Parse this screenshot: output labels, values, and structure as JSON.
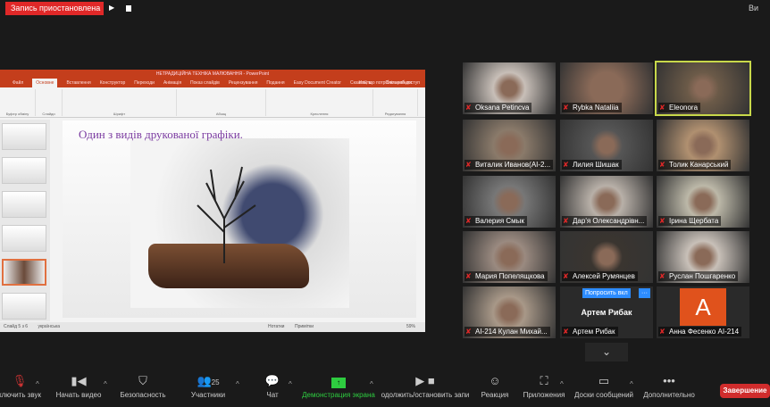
{
  "recording": {
    "status": "Запись приостановлена",
    "view_label": "Ви"
  },
  "powerpoint": {
    "title": "НЕТРАДИЦІЙНА ТЕХНІКА МАЛЮВАННЯ - PowerPoint",
    "tabs": [
      "Файл",
      "Основне",
      "Вставлення",
      "Конструктор",
      "Переходи",
      "Анімація",
      "Показ слайдів",
      "Рецензування",
      "Подання",
      "Easy Document Creator",
      "Скажіть, що потрібно зробити"
    ],
    "sign_in": "Увійти",
    "share": "Спільний доступ",
    "groups": [
      "Буфер обміну",
      "Слайди",
      "Шрифт",
      "Абзац",
      "Креслення",
      "Редагування"
    ],
    "slide_title": "Один з видів друкованої графіки.",
    "status": {
      "slide": "Слайд 5 з 6",
      "language": "українська",
      "notes": "Нотатки",
      "comments": "Примітки",
      "zoom": "59%"
    }
  },
  "participants": [
    {
      "name": "Oksana Petincva",
      "color": "#c8bfb8"
    },
    {
      "name": "Rybka Nataliia",
      "color": "#8a6a58"
    },
    {
      "name": "Eleonora",
      "color": "#6b5a48",
      "active": true
    },
    {
      "name": "Виталик Иванов(АІ-2...",
      "color": "#8a7a6a"
    },
    {
      "name": "Лилия Шишак",
      "color": "#555"
    },
    {
      "name": "Толик Канарський",
      "color": "#b09070"
    },
    {
      "name": "Валерия Смык",
      "color": "#777"
    },
    {
      "name": "Дар'я Олександрівн...",
      "color": "#b8b0a8"
    },
    {
      "name": "Ірина Щербата",
      "color": "#bcb8a8"
    },
    {
      "name": "Мария Попелящкова",
      "color": "#9a8a80"
    },
    {
      "name": "Алексей Румянцев",
      "color": "#3a3530"
    },
    {
      "name": "Руслан Пошгаренко",
      "color": "#c8c0b8"
    },
    {
      "name": "АІ-214 Кулан Михай...",
      "color": "#a89888"
    },
    {
      "name": "Артем Рибак",
      "color": "#2a2a2a",
      "no_video": true,
      "ask_label": "Попросить вкл",
      "more": "···"
    },
    {
      "name": "Анна Фесенко АІ-214",
      "color": "#2a2a2a",
      "avatar": "A",
      "avatar_color": "#e0521c"
    }
  ],
  "toolbar": {
    "mute": "ключить звук",
    "video": "Начать видео",
    "security": "Безопасность",
    "participants": "Участники",
    "participants_count": "25",
    "chat": "Чат",
    "share": "Демонстрация экрана",
    "record": "одолжить/остановить запи",
    "reactions": "Реакция",
    "apps": "Приложения",
    "whiteboards": "Доски сообщений",
    "more": "Дополнительно",
    "end": "Завершение"
  }
}
